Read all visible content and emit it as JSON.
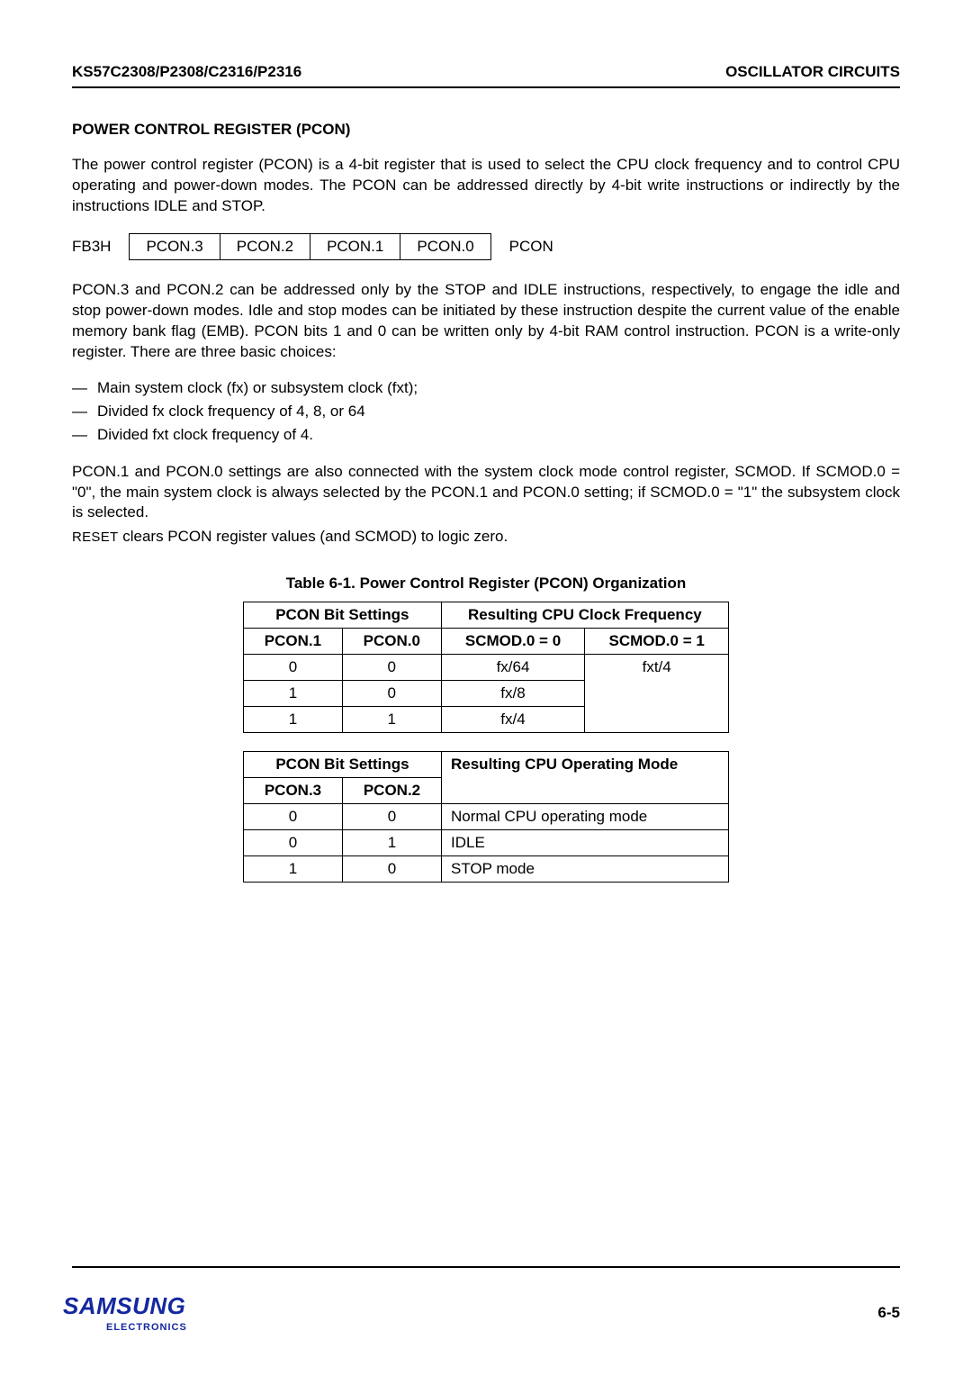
{
  "header": {
    "left": "KS57C2308/P2308/C2316/P2316",
    "right": "OSCILLATOR CIRCUITS"
  },
  "section_title": "POWER CONTROL REGISTER (PCON)",
  "para1": "The power control register (PCON) is a 4-bit register that is used to select the CPU clock frequency and to control CPU operating and power-down modes. The PCON can be addressed directly by 4-bit write instructions or indirectly by the instructions IDLE and STOP.",
  "reg": {
    "addr": "FB3H",
    "bits": [
      "PCON.3",
      "PCON.2",
      "PCON.1",
      "PCON.0"
    ],
    "name": "PCON"
  },
  "para2": "PCON.3 and PCON.2 can be addressed only by the STOP and IDLE instructions, respectively, to engage the idle and stop power-down modes. Idle and stop modes can be initiated by these instruction despite the current value of the enable memory bank flag (EMB). PCON bits 1 and 0 can be written only by 4-bit RAM control instruction. PCON is a write-only register. There are three basic choices:",
  "bullets": [
    "Main system clock (fx) or subsystem clock (fxt);",
    "Divided fx clock frequency of 4, 8, or 64",
    "Divided fxt clock frequency of 4."
  ],
  "para3a": "PCON.1 and PCON.0 settings are also connected with the system clock mode control register, SCMOD. If SCMOD.0  =  \"0\", the main system clock is always selected by the PCON.1 and PCON.0 setting; if SCMOD.0 = \"1\" the subsystem clock is selected.",
  "para3b_prefix": "RESET",
  "para3b": " clears PCON register values (and SCMOD) to logic zero.",
  "table_caption": "Table 6-1. Power Control Register (PCON) Organization",
  "table1": {
    "head1": "PCON Bit Settings",
    "head2": "Resulting CPU Clock Frequency",
    "sub": [
      "PCON.1",
      "PCON.0",
      "SCMOD.0 = 0",
      "SCMOD.0 = 1"
    ],
    "rows": [
      [
        "0",
        "0",
        "fx/64",
        "fxt/4"
      ],
      [
        "1",
        "0",
        "fx/8",
        ""
      ],
      [
        "1",
        "1",
        "fx/4",
        ""
      ]
    ]
  },
  "table2": {
    "head1": "PCON Bit Settings",
    "head2": "Resulting CPU Operating Mode",
    "sub": [
      "PCON.3",
      "PCON.2"
    ],
    "rows": [
      [
        "0",
        "0",
        "Normal CPU operating mode"
      ],
      [
        "0",
        "1",
        "IDLE"
      ],
      [
        "1",
        "0",
        "STOP mode"
      ]
    ]
  },
  "footer": {
    "logo": "SAMSUNG",
    "logo_sub": "ELECTRONICS",
    "page": "6-5"
  }
}
